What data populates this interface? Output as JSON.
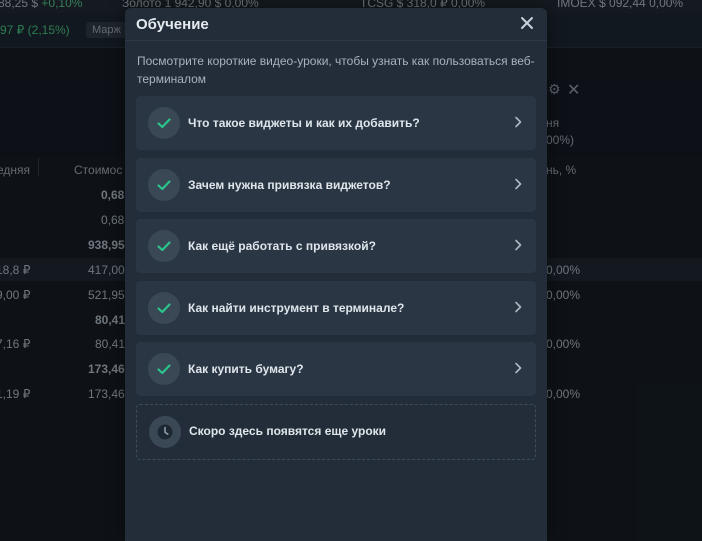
{
  "background": {
    "ticker": [
      {
        "text": "88,25 $",
        "change": "+0,10%"
      },
      {
        "text": "Золото  1 942,90 $",
        "change": "0,00%"
      },
      {
        "text": "TCSG  $ 318,0 ₽",
        "change": "0,00%"
      },
      {
        "text": "IMOEX  $ 092,44",
        "change": "0,00%"
      }
    ],
    "sub_change": "97 ₽ (2,15%)",
    "tag": "Марж",
    "panel_header_lines": [
      "ня",
      "00%)"
    ],
    "columns": [
      "едняя",
      "Стоимос",
      "нь, %"
    ],
    "rows": [
      {
        "left": "",
        "mid": "0,68",
        "right": ""
      },
      {
        "left": "",
        "mid": "0,68",
        "right": ""
      },
      {
        "left": "",
        "mid": "938,95",
        "right": ""
      },
      {
        "left": "18,8 ₽",
        "mid": "417,00",
        "right": "0,00%"
      },
      {
        "left": "9,00 ₽",
        "mid": "521,95",
        "right": "0,00%"
      },
      {
        "left": "",
        "mid": "80,41",
        "right": ""
      },
      {
        "left": "7,16 ₽",
        "mid": "80,41",
        "right": "0,00%"
      },
      {
        "left": "",
        "mid": "173,46",
        "right": ""
      },
      {
        "left": "1,19 ₽",
        "mid": "173,46",
        "right": "0,00%"
      }
    ]
  },
  "modal": {
    "title": "Обучение",
    "description": "Посмотрите короткие видео-уроки, чтобы узнать как пользоваться веб-терминалом",
    "lessons": [
      {
        "label": "Что такое виджеты и как их добавить?"
      },
      {
        "label": "Зачем нужна привязка виджетов?"
      },
      {
        "label": "Как ещё работать с привязкой?"
      },
      {
        "label": "Как найти инструмент в терминале?"
      },
      {
        "label": "Как купить бумагу?"
      }
    ],
    "upcoming_label": "Скоро здесь появятся еще уроки"
  },
  "colors": {
    "accent_check": "#2bc48a",
    "modal_bg": "#222d39",
    "card_bg": "#2a3644"
  },
  "icons": {
    "close": "close-icon",
    "check": "check-icon",
    "chevron": "chevron-right-icon",
    "clock": "clock-icon",
    "settings": "gear-icon"
  }
}
